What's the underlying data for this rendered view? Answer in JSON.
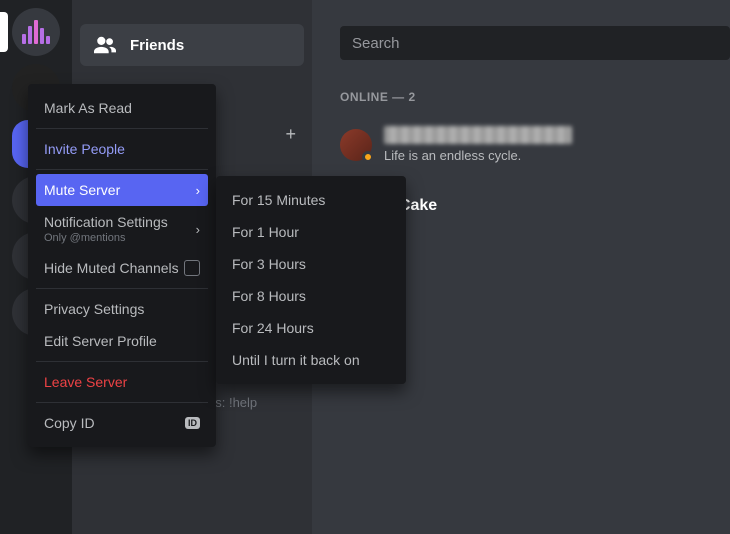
{
  "sidebar": {
    "friends_label": "Friends"
  },
  "search": {
    "placeholder": "Search"
  },
  "online_header": "ONLINE — 2",
  "friend1": {
    "status_text": "Life is an endless cycle."
  },
  "friend2_name_fragment": "eCake",
  "help_fragment": "ds: !help",
  "context_menu": {
    "mark_read": "Mark As Read",
    "invite": "Invite People",
    "mute_server": "Mute Server",
    "notification_settings": "Notification Settings",
    "notification_sub": "Only @mentions",
    "hide_muted": "Hide Muted Channels",
    "privacy": "Privacy Settings",
    "edit_profile": "Edit Server Profile",
    "leave": "Leave Server",
    "copy_id": "Copy ID",
    "copy_id_badge": "ID"
  },
  "mute_submenu": {
    "m15": "For 15 Minutes",
    "h1": "For 1 Hour",
    "h3": "For 3 Hours",
    "h8": "For 8 Hours",
    "h24": "For 24 Hours",
    "until": "Until I turn it back on"
  }
}
